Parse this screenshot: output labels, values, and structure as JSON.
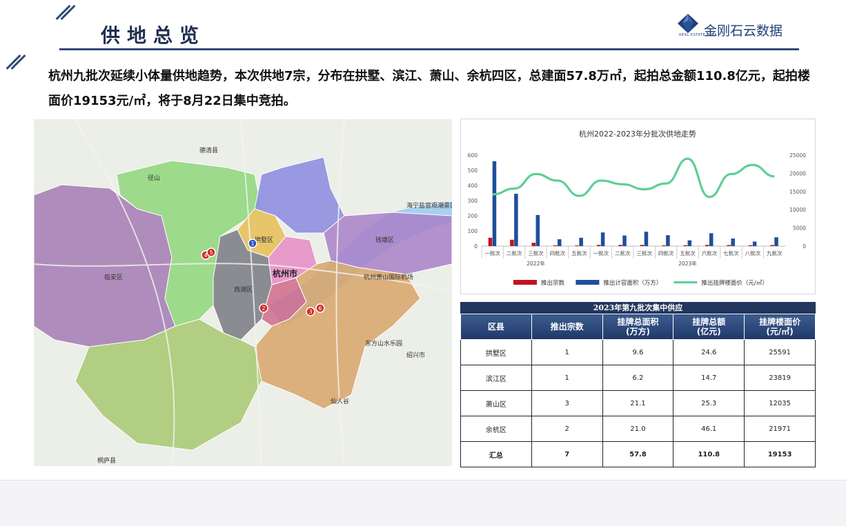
{
  "page": {
    "title": "供地总览",
    "summary": "杭州九批次延续小体量供地趋势，本次供地7宗，分布在拱墅、滨江、萧山、余杭四区，总建面57.8万㎡，起拍总金额110.8亿元，起拍楼面价19153元/㎡，将于8月22日集中竞拍。"
  },
  "logo": {
    "name": "金刚石云数据",
    "sub": "REAL ESTATE DATA"
  },
  "map": {
    "city_label": "杭州市",
    "district_labels": [
      "临安区",
      "钱塘区",
      "拱墅区",
      "西湖区"
    ],
    "place_labels": [
      "德清县",
      "桐庐县",
      "绍兴市",
      "东方山水乐园",
      "杭州萧山国际机场",
      "海宁盐官观潮景区",
      "径山",
      "仙人谷"
    ],
    "markers": [
      "1",
      "2",
      "3",
      "4",
      "5",
      "6"
    ],
    "colors": {
      "linan": "#a57ab3",
      "yuhang": "#8fd67a",
      "linping": "#8f8fe0",
      "gongshu": "#e6c15a",
      "xihu": "#7a7a82",
      "shangcheng": "#e890c8",
      "qiantang": "#a980c8",
      "binjiang": "#d06a8a",
      "xiaoshan": "#d9a468",
      "fuyang": "#a8c870",
      "marker_red": "#d42a2a",
      "marker_blue": "#2b55c8"
    }
  },
  "chart_data": {
    "type": "bar",
    "title": "杭州2022-2023年分批次供地走势",
    "categories": [
      "一批次",
      "二批次",
      "三批次",
      "四批次",
      "五批次",
      "一批次",
      "二批次",
      "三批次",
      "四批次",
      "五批次",
      "六批次",
      "七批次",
      "八批次",
      "九批次"
    ],
    "groups": [
      {
        "label": "2022年",
        "from": 0,
        "to": 4
      },
      {
        "label": "2023年",
        "from": 5,
        "to": 13
      }
    ],
    "series": [
      {
        "name": "推出宗数",
        "type": "bar",
        "axis": "left",
        "color": "#c0141c",
        "values": [
          55,
          42,
          22,
          5,
          4,
          8,
          8,
          8,
          5,
          6,
          8,
          7,
          6,
          7
        ]
      },
      {
        "name": "推出计容面积（万方）",
        "type": "bar",
        "axis": "left",
        "color": "#1f4f9c",
        "values": [
          560,
          345,
          205,
          45,
          55,
          90,
          70,
          95,
          72,
          38,
          85,
          50,
          30,
          58
        ]
      },
      {
        "name": "推出挂牌楼面价（元/㎡）",
        "type": "line",
        "axis": "right",
        "color": "#5ccf96",
        "values": [
          14200,
          15800,
          19800,
          18000,
          13800,
          18000,
          17000,
          15600,
          17200,
          24000,
          13500,
          19800,
          22300,
          19153
        ]
      }
    ],
    "y_left": {
      "min": 0,
      "max": 600,
      "ticks": [
        "0",
        "100",
        "200",
        "300",
        "400",
        "500",
        "600"
      ]
    },
    "y_right": {
      "min": 0,
      "max": 25000,
      "ticks": [
        "0",
        "5000",
        "10000",
        "15000",
        "20000",
        "25000"
      ]
    },
    "legend": "bottom",
    "grid": false
  },
  "table": {
    "caption": "2023年第九批次集中供应",
    "headers": [
      "区县",
      "推出宗数",
      "挂牌总面积\n(万方)",
      "挂牌总额\n(亿元)",
      "挂牌楼面价\n(元/㎡)"
    ],
    "rows": [
      [
        "拱墅区",
        "1",
        "9.6",
        "24.6",
        "25591"
      ],
      [
        "滨江区",
        "1",
        "6.2",
        "14.7",
        "23819"
      ],
      [
        "萧山区",
        "3",
        "21.1",
        "25.3",
        "12035"
      ],
      [
        "余杭区",
        "2",
        "21.0",
        "46.1",
        "21971"
      ]
    ],
    "total": [
      "汇总",
      "7",
      "57.8",
      "110.8",
      "19153"
    ]
  }
}
